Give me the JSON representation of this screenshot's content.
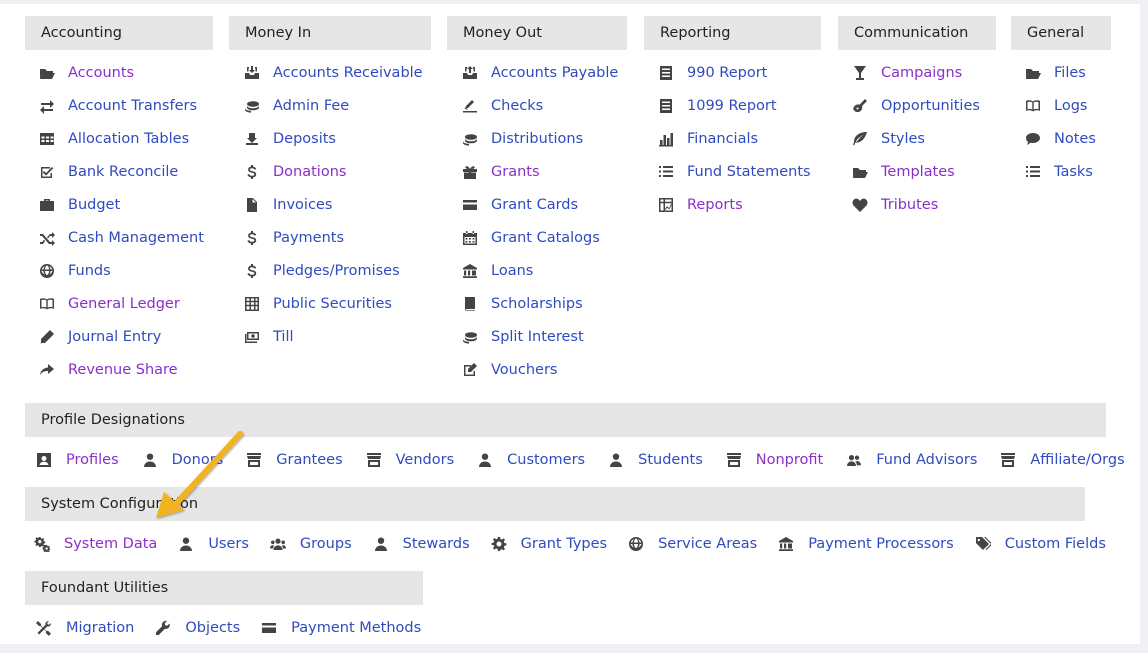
{
  "columns": [
    {
      "header": "Accounting",
      "items": [
        {
          "label": "Accounts",
          "icon": "folder-open-icon",
          "color": "purple"
        },
        {
          "label": "Account Transfers",
          "icon": "exchange-icon",
          "color": "blue"
        },
        {
          "label": "Allocation Tables",
          "icon": "table-icon",
          "color": "blue"
        },
        {
          "label": "Bank Reconcile",
          "icon": "checkbox-icon",
          "color": "blue"
        },
        {
          "label": "Budget",
          "icon": "briefcase-icon",
          "color": "blue"
        },
        {
          "label": "Cash Management",
          "icon": "shuffle-icon",
          "color": "blue"
        },
        {
          "label": "Funds",
          "icon": "globe-icon",
          "color": "blue"
        },
        {
          "label": "General Ledger",
          "icon": "book-icon",
          "color": "purple"
        },
        {
          "label": "Journal Entry",
          "icon": "pencil-icon",
          "color": "blue"
        },
        {
          "label": "Revenue Share",
          "icon": "share-arrow-icon",
          "color": "purple"
        }
      ]
    },
    {
      "header": "Money In",
      "items": [
        {
          "label": "Accounts Receivable",
          "icon": "inbox-in-icon",
          "color": "blue"
        },
        {
          "label": "Admin Fee",
          "icon": "coins-icon",
          "color": "blue"
        },
        {
          "label": "Deposits",
          "icon": "deposit-icon",
          "color": "blue"
        },
        {
          "label": "Donations",
          "icon": "dollar-icon",
          "color": "purple"
        },
        {
          "label": "Invoices",
          "icon": "file-icon",
          "color": "blue"
        },
        {
          "label": "Payments",
          "icon": "dollar-icon",
          "color": "blue"
        },
        {
          "label": "Pledges/Promises",
          "icon": "dollar-icon",
          "color": "blue"
        },
        {
          "label": "Public Securities",
          "icon": "spreadsheet-icon",
          "color": "blue"
        },
        {
          "label": "Till",
          "icon": "cash-icon",
          "color": "blue"
        }
      ]
    },
    {
      "header": "Money Out",
      "items": [
        {
          "label": "Accounts Payable",
          "icon": "inbox-out-icon",
          "color": "blue"
        },
        {
          "label": "Checks",
          "icon": "check-sign-icon",
          "color": "blue"
        },
        {
          "label": "Distributions",
          "icon": "coins-icon",
          "color": "blue"
        },
        {
          "label": "Grants",
          "icon": "gift-icon",
          "color": "purple"
        },
        {
          "label": "Grant Cards",
          "icon": "credit-card-icon",
          "color": "blue"
        },
        {
          "label": "Grant Catalogs",
          "icon": "calendar-icon",
          "color": "blue"
        },
        {
          "label": "Loans",
          "icon": "bank-icon",
          "color": "blue"
        },
        {
          "label": "Scholarships",
          "icon": "book-closed-icon",
          "color": "blue"
        },
        {
          "label": "Split Interest",
          "icon": "coins-icon",
          "color": "blue"
        },
        {
          "label": "Vouchers",
          "icon": "edit-icon",
          "color": "blue"
        }
      ]
    },
    {
      "header": "Reporting",
      "items": [
        {
          "label": "990 Report",
          "icon": "document-icon",
          "color": "blue"
        },
        {
          "label": "1099 Report",
          "icon": "document-icon",
          "color": "blue"
        },
        {
          "label": "Financials",
          "icon": "bar-chart-icon",
          "color": "blue"
        },
        {
          "label": "Fund Statements",
          "icon": "list-icon",
          "color": "blue"
        },
        {
          "label": "Reports",
          "icon": "grid-report-icon",
          "color": "purple"
        }
      ]
    },
    {
      "header": "Communication",
      "items": [
        {
          "label": "Campaigns",
          "icon": "glass-icon",
          "color": "purple"
        },
        {
          "label": "Opportunities",
          "icon": "guitar-icon",
          "color": "blue"
        },
        {
          "label": "Styles",
          "icon": "leaf-icon",
          "color": "blue"
        },
        {
          "label": "Templates",
          "icon": "folder-open-icon",
          "color": "purple"
        },
        {
          "label": "Tributes",
          "icon": "heart-icon",
          "color": "purple"
        }
      ]
    },
    {
      "header": "General",
      "items": [
        {
          "label": "Files",
          "icon": "folder-open-icon",
          "color": "blue"
        },
        {
          "label": "Logs",
          "icon": "book-icon",
          "color": "blue"
        },
        {
          "label": "Notes",
          "icon": "comment-icon",
          "color": "blue"
        },
        {
          "label": "Tasks",
          "icon": "list-icon",
          "color": "blue"
        }
      ]
    }
  ],
  "rows": [
    {
      "header": "Profile Designations",
      "items": [
        {
          "label": "Profiles",
          "icon": "profile-card-icon",
          "color": "purple"
        },
        {
          "label": "Donors",
          "icon": "user-icon",
          "color": "blue"
        },
        {
          "label": "Grantees",
          "icon": "store-icon",
          "color": "blue"
        },
        {
          "label": "Vendors",
          "icon": "store-icon",
          "color": "blue"
        },
        {
          "label": "Customers",
          "icon": "user-icon",
          "color": "blue"
        },
        {
          "label": "Students",
          "icon": "user-icon",
          "color": "blue"
        },
        {
          "label": "Nonprofit",
          "icon": "store-icon",
          "color": "purple"
        },
        {
          "label": "Fund Advisors",
          "icon": "users-icon",
          "color": "blue"
        },
        {
          "label": "Affiliate/Orgs",
          "icon": "store-icon",
          "color": "blue"
        }
      ]
    },
    {
      "header": "System Configuration",
      "items": [
        {
          "label": "System Data",
          "icon": "gears-icon",
          "color": "purple"
        },
        {
          "label": "Users",
          "icon": "user-icon",
          "color": "blue"
        },
        {
          "label": "Groups",
          "icon": "group-icon",
          "color": "blue"
        },
        {
          "label": "Stewards",
          "icon": "user-icon",
          "color": "blue"
        },
        {
          "label": "Grant Types",
          "icon": "gear-icon",
          "color": "blue"
        },
        {
          "label": "Service Areas",
          "icon": "globe-icon",
          "color": "blue"
        },
        {
          "label": "Payment Processors",
          "icon": "bank-icon",
          "color": "blue"
        },
        {
          "label": "Custom Fields",
          "icon": "tags-icon",
          "color": "blue"
        }
      ]
    },
    {
      "header": "Foundant Utilities",
      "items": [
        {
          "label": "Migration",
          "icon": "tools-icon",
          "color": "blue"
        },
        {
          "label": "Objects",
          "icon": "wrench-icon",
          "color": "blue"
        },
        {
          "label": "Payment Methods",
          "icon": "credit-card-icon",
          "color": "blue"
        }
      ]
    }
  ],
  "colors": {
    "blue": "#2f4bbf",
    "purple": "#8a2fc9",
    "header_bg": "#e6e6e6",
    "arrow": "#f0b323"
  }
}
